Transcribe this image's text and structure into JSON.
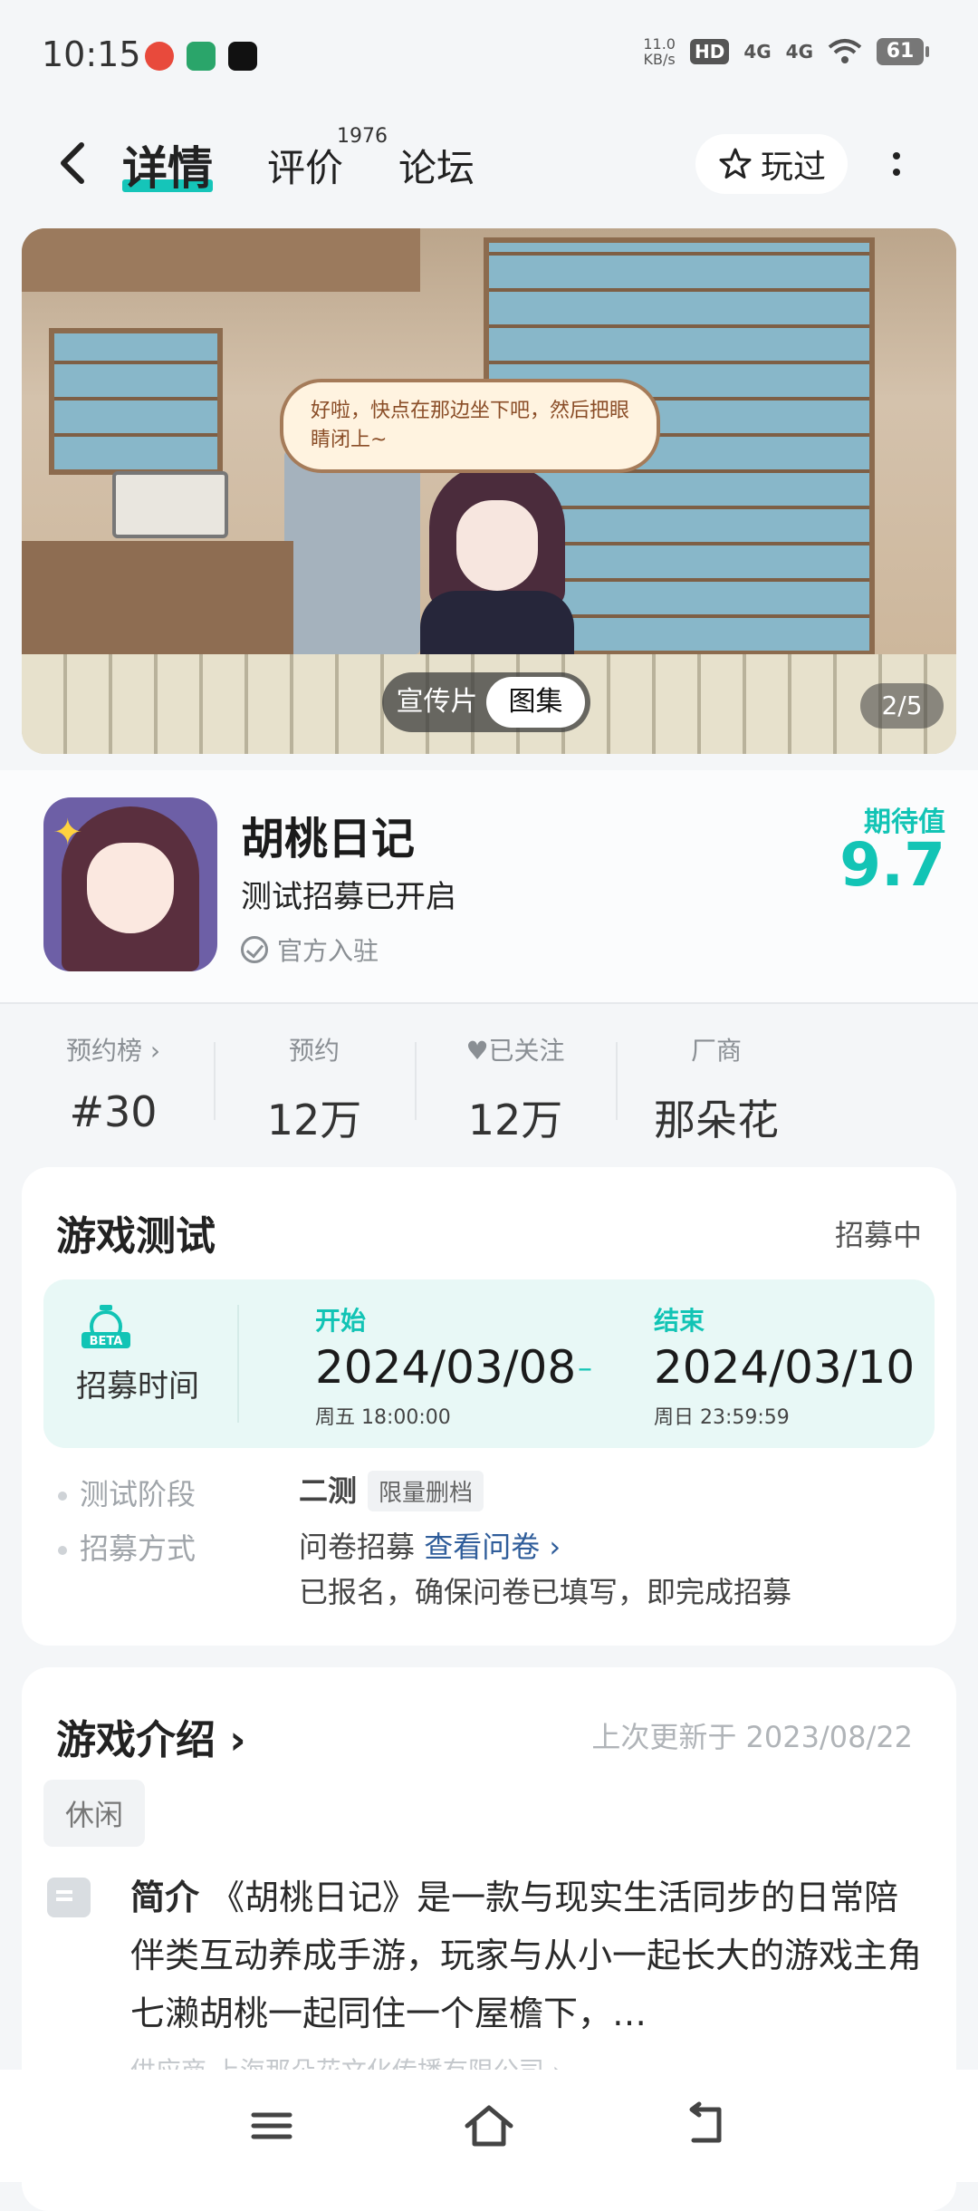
{
  "status_bar": {
    "time": "10:15",
    "net_speed_value": "11.0",
    "net_speed_unit": "KB/s",
    "hd": "HD",
    "signal_1": "4G",
    "signal_2": "4G",
    "battery": "61"
  },
  "header": {
    "tab_detail": "详情",
    "tab_reviews": "评价",
    "review_count": "1976",
    "tab_forum": "论坛",
    "played_button": "玩过"
  },
  "banner": {
    "speech": "好啦，快点在那边坐下吧，然后把眼睛闭上~",
    "toggle_video": "宣传片",
    "toggle_gallery": "图集",
    "page_indicator": "2/5"
  },
  "game": {
    "name": "胡桃日记",
    "status": "测试招募已开启",
    "official": "官方入驻",
    "expect_label": "期待值",
    "expect_score": "9.7"
  },
  "stats": [
    {
      "label": "预约榜 ›",
      "value": "#30"
    },
    {
      "label": "预约",
      "value": "12万"
    },
    {
      "label": "♥已关注",
      "value": "12万"
    },
    {
      "label": "厂商",
      "value": "那朵花"
    }
  ],
  "test": {
    "title": "游戏测试",
    "state": "招募中",
    "beta": "BETA",
    "recruit_label": "招募时间",
    "start_head": "开始",
    "start_date": "2024/03/08",
    "start_sub": "周五  18:00:00",
    "end_head": "结束",
    "end_date": "2024/03/10",
    "end_sub": "周日  23:59:59",
    "stage_label": "测试阶段",
    "stage_value": "二测",
    "stage_tag": "限量删档",
    "method_label": "招募方式",
    "method_value": "问卷招募",
    "method_link": "查看问卷 ›",
    "method_note": "已报名，确保问卷已填写，即完成招募"
  },
  "intro": {
    "title": "游戏介绍 ›",
    "updated": "上次更新于 2023/08/22",
    "genre": "休闲",
    "label": "简介",
    "text": "《胡桃日记》是一款与现实生活同步的日常陪伴类互动养成手游，玩家与从小一起长大的游戏主角七濑胡桃一起同住一个屋檐下，…",
    "publisher_peek": "供应商 上海那朵花文化传播有限公司 ›"
  },
  "colors": {
    "accent": "#12c4b5",
    "link": "#2f5d9a"
  }
}
